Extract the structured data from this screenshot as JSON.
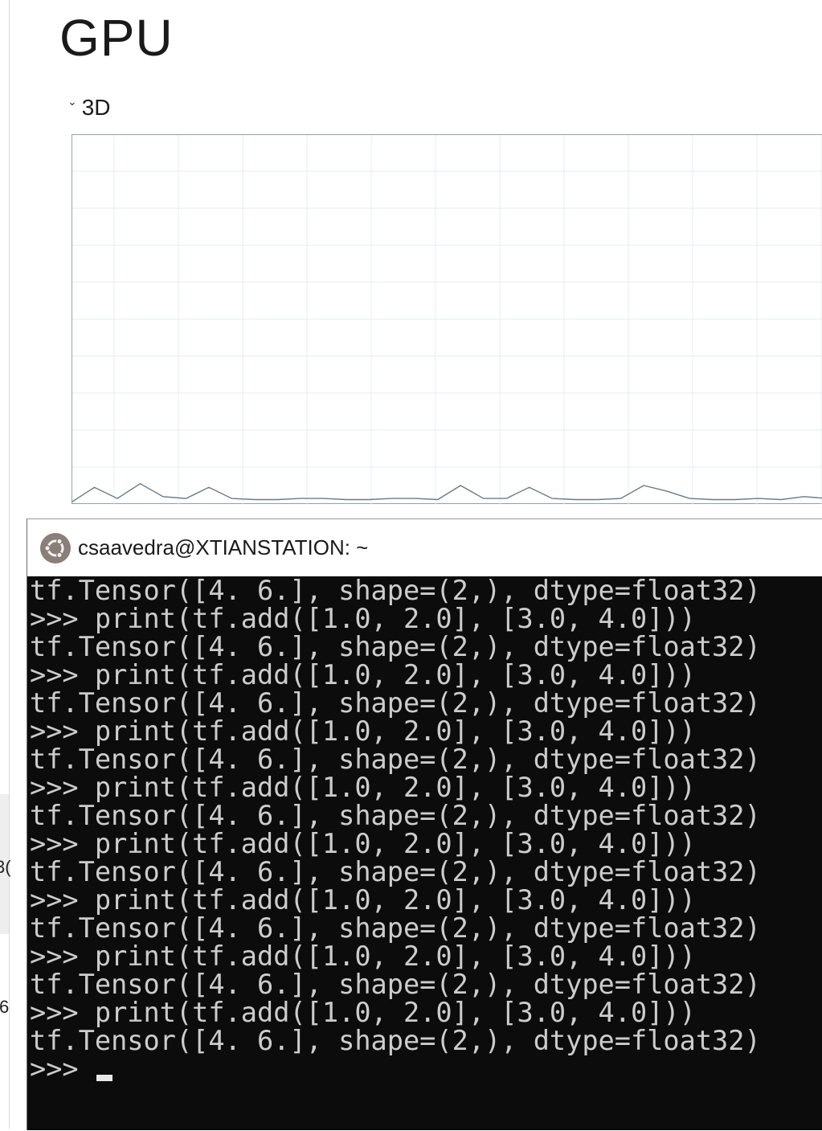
{
  "taskmanager": {
    "title": "GPU",
    "engine_label": "3D",
    "edge_chars": [
      "3(",
      "6"
    ],
    "graph": {
      "type": "line",
      "ylim": [
        0,
        100
      ],
      "grid": true,
      "values": [
        0.5,
        4.5,
        1.5,
        5.5,
        2,
        1.5,
        4.5,
        1.5,
        1.2,
        1.2,
        1.5,
        1.5,
        1.2,
        1.2,
        1.5,
        1.5,
        1.2,
        5,
        1.5,
        1.5,
        4.5,
        1.5,
        1.2,
        1.2,
        1.5,
        5,
        3.5,
        1.5,
        1.2,
        1.2,
        1.5,
        1.2,
        2,
        1.5
      ]
    }
  },
  "terminal": {
    "window_title": "csaavedra@XTIANSTATION: ~",
    "lines": [
      "tf.Tensor([4. 6.], shape=(2,), dtype=float32)",
      ">>> print(tf.add([1.0, 2.0], [3.0, 4.0]))",
      "tf.Tensor([4. 6.], shape=(2,), dtype=float32)",
      ">>> print(tf.add([1.0, 2.0], [3.0, 4.0]))",
      "tf.Tensor([4. 6.], shape=(2,), dtype=float32)",
      ">>> print(tf.add([1.0, 2.0], [3.0, 4.0]))",
      "tf.Tensor([4. 6.], shape=(2,), dtype=float32)",
      ">>> print(tf.add([1.0, 2.0], [3.0, 4.0]))",
      "tf.Tensor([4. 6.], shape=(2,), dtype=float32)",
      ">>> print(tf.add([1.0, 2.0], [3.0, 4.0]))",
      "tf.Tensor([4. 6.], shape=(2,), dtype=float32)",
      ">>> print(tf.add([1.0, 2.0], [3.0, 4.0]))",
      "tf.Tensor([4. 6.], shape=(2,), dtype=float32)",
      ">>> print(tf.add([1.0, 2.0], [3.0, 4.0]))",
      "tf.Tensor([4. 6.], shape=(2,), dtype=float32)",
      ">>> print(tf.add([1.0, 2.0], [3.0, 4.0]))",
      "tf.Tensor([4. 6.], shape=(2,), dtype=float32)"
    ],
    "prompt": ">>> "
  },
  "colors": {
    "graph_border": "#8fa3ad",
    "graph_grid": "#e6ecef",
    "graph_line": "#6b7b84",
    "terminal_bg": "#0c0c0c",
    "terminal_text": "#cccccc"
  },
  "icons": {
    "window_icon": "ubuntu-icon",
    "engine_chevron": "chevron-down-icon"
  }
}
